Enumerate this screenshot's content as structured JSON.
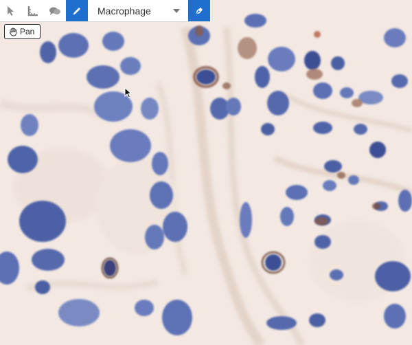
{
  "viewer": {
    "colors": {
      "background": "#f3e9e2",
      "nucleus": "#5b6fb3",
      "nucleus_dark": "#3e4f94",
      "stain_brown": "#7a4a3a",
      "fiber": "#dcc9bd"
    }
  },
  "toolbar": {
    "tools": [
      {
        "name": "pointer-tool",
        "icon": "pointer-arrow-icon",
        "active": false
      },
      {
        "name": "ruler-tool",
        "icon": "ruler-icon",
        "active": false
      },
      {
        "name": "comment-tool",
        "icon": "speech-bubbles-icon",
        "active": false
      },
      {
        "name": "draw-tool",
        "icon": "pencil-icon",
        "active": true
      }
    ],
    "label_select": {
      "selected": "Macrophage"
    },
    "pen_tool": {
      "icon": "pen-nib-icon",
      "active": true
    },
    "active_color": "#1f6fce"
  },
  "pan_badge": {
    "label": "Pan",
    "icon": "hand-icon"
  }
}
